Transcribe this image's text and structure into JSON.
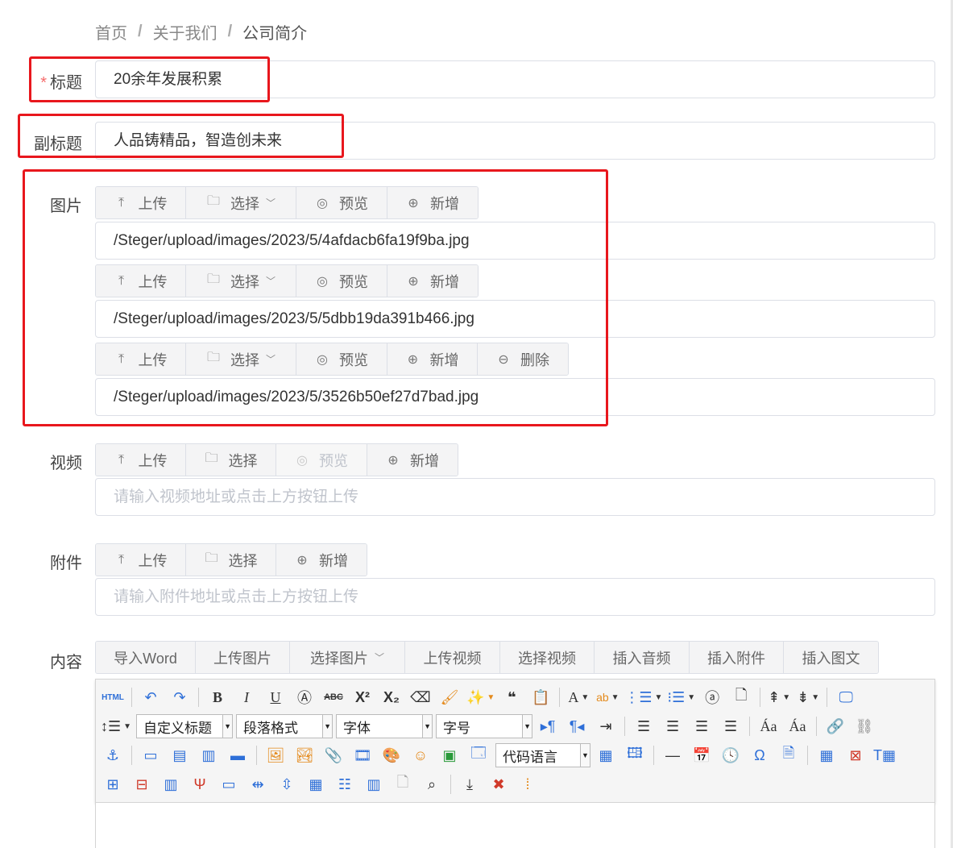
{
  "breadcrumb": {
    "items": [
      "首页",
      "关于我们",
      "公司简介"
    ],
    "separator": "/"
  },
  "labels": {
    "title": "标题",
    "subtitle": "副标题",
    "image": "图片",
    "video": "视频",
    "attachment": "附件",
    "content": "内容",
    "required_mark": "*"
  },
  "fields": {
    "title_value": "20余年发展积累",
    "subtitle_value": "人品铸精品，智造创未来",
    "image_paths": [
      "/Steger/upload/images/2023/5/4afdacb6fa19f9ba.jpg",
      "/Steger/upload/images/2023/5/5dbb19da391b466.jpg",
      "/Steger/upload/images/2023/5/3526b50ef27d7bad.jpg"
    ],
    "video_placeholder": "请输入视频地址或点击上方按钮上传",
    "attachment_placeholder": "请输入附件地址或点击上方按钮上传"
  },
  "buttons": {
    "upload": "上传",
    "select": "选择",
    "preview": "预览",
    "add": "新增",
    "delete": "删除"
  },
  "content_buttons": [
    "导入Word",
    "上传图片",
    "选择图片",
    "上传视频",
    "选择视频",
    "插入音频",
    "插入附件",
    "插入图文"
  ],
  "editor": {
    "custom_heading": "自定义标题",
    "paragraph_format": "段落格式",
    "font_family": "字体",
    "font_size": "字号",
    "code_language": "代码语言",
    "html_label": "HTML"
  },
  "colors": {
    "highlight_box": "#e8171d",
    "required": "#f56c6c",
    "border": "#dcdfe6",
    "placeholder": "#c0c4cc"
  }
}
